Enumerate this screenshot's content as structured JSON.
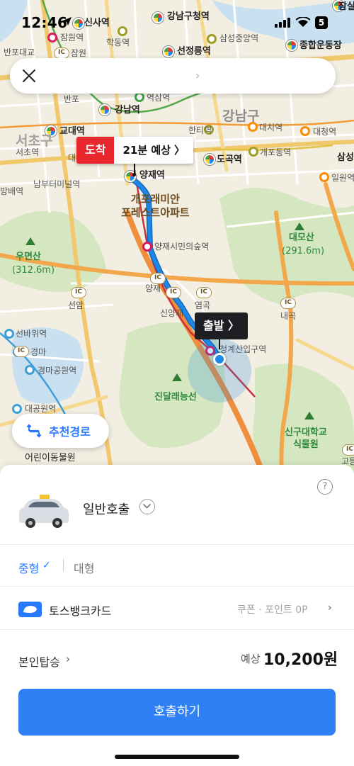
{
  "status_bar": {
    "time": "12:46",
    "battery": "5"
  },
  "search": {
    "destination_text": "",
    "chevron": "›"
  },
  "map": {
    "labels": {
      "sinsa": "신사역",
      "gangnamgu_office": "강남구청역",
      "jamwon": "잠원역",
      "hakdong": "학동역",
      "samsung_medical": "삼성중앙역",
      "seonjeongneung": "선정릉역",
      "sports_complex": "종합운동장",
      "jamsil": "잠실",
      "banpo_dae": "반포대교",
      "jamwon2": "잠원",
      "banpo": "반포",
      "yeoksam": "역삼역",
      "gangnam": "강남역",
      "gangnamgu": "강남구",
      "hanti": "한티역",
      "daechi": "대치역",
      "daecheong": "대청역",
      "seocho": "서초구",
      "gyodae": "교대역",
      "seocho_st": "서초역",
      "dae": "대",
      "dogok": "도곡역",
      "gaepodong": "개포동역",
      "samseong2": "삼성",
      "ilwon": "일원역",
      "nambu": "남부터미널역",
      "bangbae": "방배역",
      "yangjae": "양재역",
      "apartment": "개포래미안\n포레스트아파트",
      "yangjae_citizen": "양재시민의숲역",
      "umyeonsan": "우면산",
      "umyeonsan_h": "(312.6m)",
      "daemosan": "대모산",
      "daemosan_h": "(291.6m)",
      "yangjae2": "양재",
      "seonam": "선암",
      "sinyangjae": "신양재",
      "yeomgok": "염곡",
      "naegok": "내곡",
      "seonbawi": "선바위역",
      "gyeongma": "경마",
      "gyeongma_park": "경마공원역",
      "cheonggyesan": "청계산입구역",
      "jindallae": "진달래능선",
      "daegongwon": "대공원역",
      "shingu": "신구대학교\n식물원",
      "children_zoo": "어린이동물원",
      "gorae": "고등"
    }
  },
  "route_tags": {
    "arrive_label": "도착",
    "arrive_eta": "21분 예상 〉",
    "depart_label": "출발 〉"
  },
  "recommend_route": {
    "label": "추천경로",
    "icon": "route-swap-icon"
  },
  "sheet": {
    "help": "?",
    "service_name": "일반호출",
    "size_selected": "중형",
    "size_check": "✓",
    "size_other": "대형",
    "payment_card": "토스뱅크카드",
    "coupon_points": "쿠폰 · 포인트 0P",
    "coupon_chevron": "›",
    "self_ride": "본인탑승",
    "self_ride_chevron": "›",
    "estimate_label": "예상",
    "estimate_value": "10,200원",
    "call_button": "호출하기"
  },
  "colors": {
    "accent": "#2f80f5",
    "arrive_red": "#e8262d",
    "route_blue": "#1e88e5",
    "map_bg": "#f3efe3",
    "park_green": "#cfe6bd"
  }
}
